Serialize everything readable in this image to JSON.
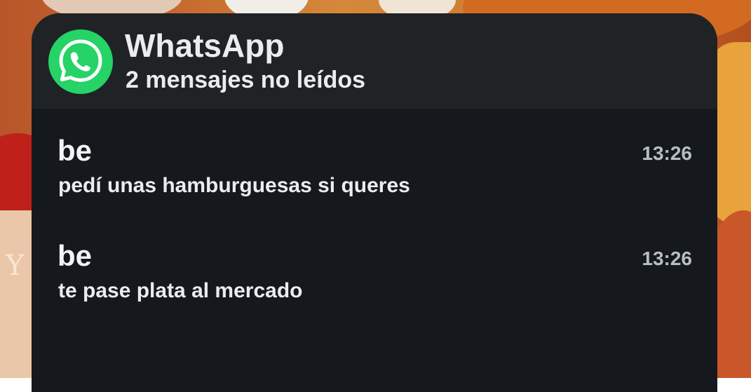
{
  "notification": {
    "app_name": "WhatsApp",
    "summary": "2 mensajes no leídos",
    "messages": [
      {
        "sender": "be",
        "text": "pedí unas hamburguesas si queres",
        "time": "13:26"
      },
      {
        "sender": "be",
        "text": "te pase plata al mercado",
        "time": "13:26"
      }
    ]
  },
  "wallpaper": {
    "visible_text": "Y"
  },
  "colors": {
    "card_background": "#15191d",
    "header_background": "#1f2326",
    "whatsapp_green": "#25d366",
    "text_primary": "#e9edef",
    "text_secondary": "#b6bec3"
  }
}
